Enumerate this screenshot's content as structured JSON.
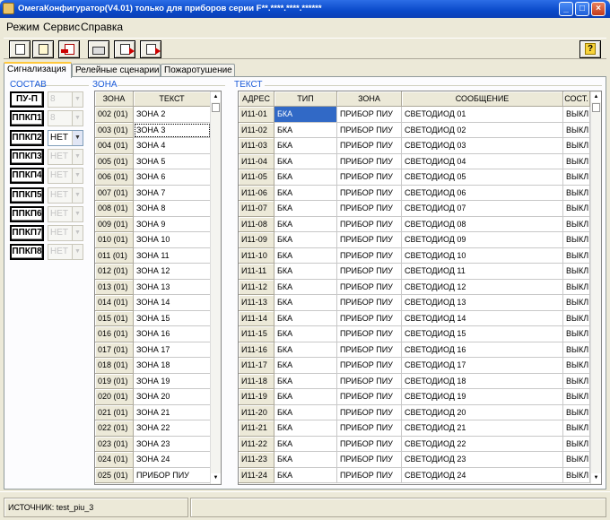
{
  "window": {
    "title": "ОмегаКонфигуратор(V4.01) только для приборов серии F**.****.****.******"
  },
  "menu": [
    "Режим",
    "Сервис",
    "Справка"
  ],
  "toolbar": {
    "buttons": [
      "new-document-icon",
      "open-document-icon",
      "delete-icon",
      "print-icon",
      "export-icon",
      "import-icon"
    ],
    "help_label": "?"
  },
  "tabs": [
    "Сигнализация",
    "Релейные сценарии",
    "Пожаротушение"
  ],
  "sostav": {
    "title": "СОСТАВ",
    "rows": [
      {
        "label": "ПУ-П",
        "value": "8",
        "disabled": true
      },
      {
        "label": "ППКП1",
        "value": "8",
        "disabled": true
      },
      {
        "label": "ППКП2",
        "value": "НЕТ",
        "disabled": false
      },
      {
        "label": "ППКП3",
        "value": "НЕТ",
        "disabled": true
      },
      {
        "label": "ППКП4",
        "value": "НЕТ",
        "disabled": true
      },
      {
        "label": "ППКП5",
        "value": "НЕТ",
        "disabled": true
      },
      {
        "label": "ППКП6",
        "value": "НЕТ",
        "disabled": true
      },
      {
        "label": "ППКП7",
        "value": "НЕТ",
        "disabled": true
      },
      {
        "label": "ППКП8",
        "value": "НЕТ",
        "disabled": true
      }
    ]
  },
  "zona": {
    "title": "ЗОНА",
    "headers": [
      "ЗОНА",
      "ТЕКСТ"
    ],
    "rows": [
      [
        "002 (01)",
        "ЗОНА 2"
      ],
      [
        "003 (01)",
        "ЗОНА 3"
      ],
      [
        "004 (01)",
        "ЗОНА 4"
      ],
      [
        "005 (01)",
        "ЗОНА 5"
      ],
      [
        "006 (01)",
        "ЗОНА 6"
      ],
      [
        "007 (01)",
        "ЗОНА 7"
      ],
      [
        "008 (01)",
        "ЗОНА 8"
      ],
      [
        "009 (01)",
        "ЗОНА 9"
      ],
      [
        "010 (01)",
        "ЗОНА 10"
      ],
      [
        "011 (01)",
        "ЗОНА 11"
      ],
      [
        "012 (01)",
        "ЗОНА 12"
      ],
      [
        "013 (01)",
        "ЗОНА 13"
      ],
      [
        "014 (01)",
        "ЗОНА 14"
      ],
      [
        "015 (01)",
        "ЗОНА 15"
      ],
      [
        "016 (01)",
        "ЗОНА 16"
      ],
      [
        "017 (01)",
        "ЗОНА 17"
      ],
      [
        "018 (01)",
        "ЗОНА 18"
      ],
      [
        "019 (01)",
        "ЗОНА 19"
      ],
      [
        "020 (01)",
        "ЗОНА 20"
      ],
      [
        "021 (01)",
        "ЗОНА 21"
      ],
      [
        "022 (01)",
        "ЗОНА 22"
      ],
      [
        "023 (01)",
        "ЗОНА 23"
      ],
      [
        "024 (01)",
        "ЗОНА 24"
      ],
      [
        "025 (01)",
        "ПРИБОР ПИУ"
      ]
    ]
  },
  "tekst": {
    "title": "ТЕКСТ",
    "headers": [
      "АДРЕС",
      "ТИП",
      "ЗОНА",
      "СООБЩЕНИЕ",
      "СОСТ."
    ],
    "rows": [
      [
        "И11-01",
        "БКА",
        "ПРИБОР ПИУ",
        "СВЕТОДИОД 01",
        "ВЫКЛ"
      ],
      [
        "И11-02",
        "БКА",
        "ПРИБОР ПИУ",
        "СВЕТОДИОД 02",
        "ВЫКЛ"
      ],
      [
        "И11-03",
        "БКА",
        "ПРИБОР ПИУ",
        "СВЕТОДИОД 03",
        "ВЫКЛ"
      ],
      [
        "И11-04",
        "БКА",
        "ПРИБОР ПИУ",
        "СВЕТОДИОД 04",
        "ВЫКЛ"
      ],
      [
        "И11-05",
        "БКА",
        "ПРИБОР ПИУ",
        "СВЕТОДИОД 05",
        "ВЫКЛ"
      ],
      [
        "И11-06",
        "БКА",
        "ПРИБОР ПИУ",
        "СВЕТОДИОД 06",
        "ВЫКЛ"
      ],
      [
        "И11-07",
        "БКА",
        "ПРИБОР ПИУ",
        "СВЕТОДИОД 07",
        "ВЫКЛ"
      ],
      [
        "И11-08",
        "БКА",
        "ПРИБОР ПИУ",
        "СВЕТОДИОД 08",
        "ВЫКЛ"
      ],
      [
        "И11-09",
        "БКА",
        "ПРИБОР ПИУ",
        "СВЕТОДИОД 09",
        "ВЫКЛ"
      ],
      [
        "И11-10",
        "БКА",
        "ПРИБОР ПИУ",
        "СВЕТОДИОД 10",
        "ВЫКЛ"
      ],
      [
        "И11-11",
        "БКА",
        "ПРИБОР ПИУ",
        "СВЕТОДИОД 11",
        "ВЫКЛ"
      ],
      [
        "И11-12",
        "БКА",
        "ПРИБОР ПИУ",
        "СВЕТОДИОД 12",
        "ВЫКЛ"
      ],
      [
        "И11-13",
        "БКА",
        "ПРИБОР ПИУ",
        "СВЕТОДИОД 13",
        "ВЫКЛ"
      ],
      [
        "И11-14",
        "БКА",
        "ПРИБОР ПИУ",
        "СВЕТОДИОД 14",
        "ВЫКЛ"
      ],
      [
        "И11-15",
        "БКА",
        "ПРИБОР ПИУ",
        "СВЕТОДИОД 15",
        "ВЫКЛ"
      ],
      [
        "И11-16",
        "БКА",
        "ПРИБОР ПИУ",
        "СВЕТОДИОД 16",
        "ВЫКЛ"
      ],
      [
        "И11-17",
        "БКА",
        "ПРИБОР ПИУ",
        "СВЕТОДИОД 17",
        "ВЫКЛ"
      ],
      [
        "И11-18",
        "БКА",
        "ПРИБОР ПИУ",
        "СВЕТОДИОД 18",
        "ВЫКЛ"
      ],
      [
        "И11-19",
        "БКА",
        "ПРИБОР ПИУ",
        "СВЕТОДИОД 19",
        "ВЫКЛ"
      ],
      [
        "И11-20",
        "БКА",
        "ПРИБОР ПИУ",
        "СВЕТОДИОД 20",
        "ВЫКЛ"
      ],
      [
        "И11-21",
        "БКА",
        "ПРИБОР ПИУ",
        "СВЕТОДИОД 21",
        "ВЫКЛ"
      ],
      [
        "И11-22",
        "БКА",
        "ПРИБОР ПИУ",
        "СВЕТОДИОД 22",
        "ВЫКЛ"
      ],
      [
        "И11-23",
        "БКА",
        "ПРИБОР ПИУ",
        "СВЕТОДИОД 23",
        "ВЫКЛ"
      ],
      [
        "И11-24",
        "БКА",
        "ПРИБОР ПИУ",
        "СВЕТОДИОД 24",
        "ВЫКЛ"
      ]
    ]
  },
  "status": {
    "source": "ИСТОЧНИК:  test_piu_3"
  },
  "colors": {
    "titlebar": "#0A49C9",
    "group_title": "#1b5bd8",
    "selection": "#3169C6",
    "active_tab_accent": "#FFC83C"
  }
}
